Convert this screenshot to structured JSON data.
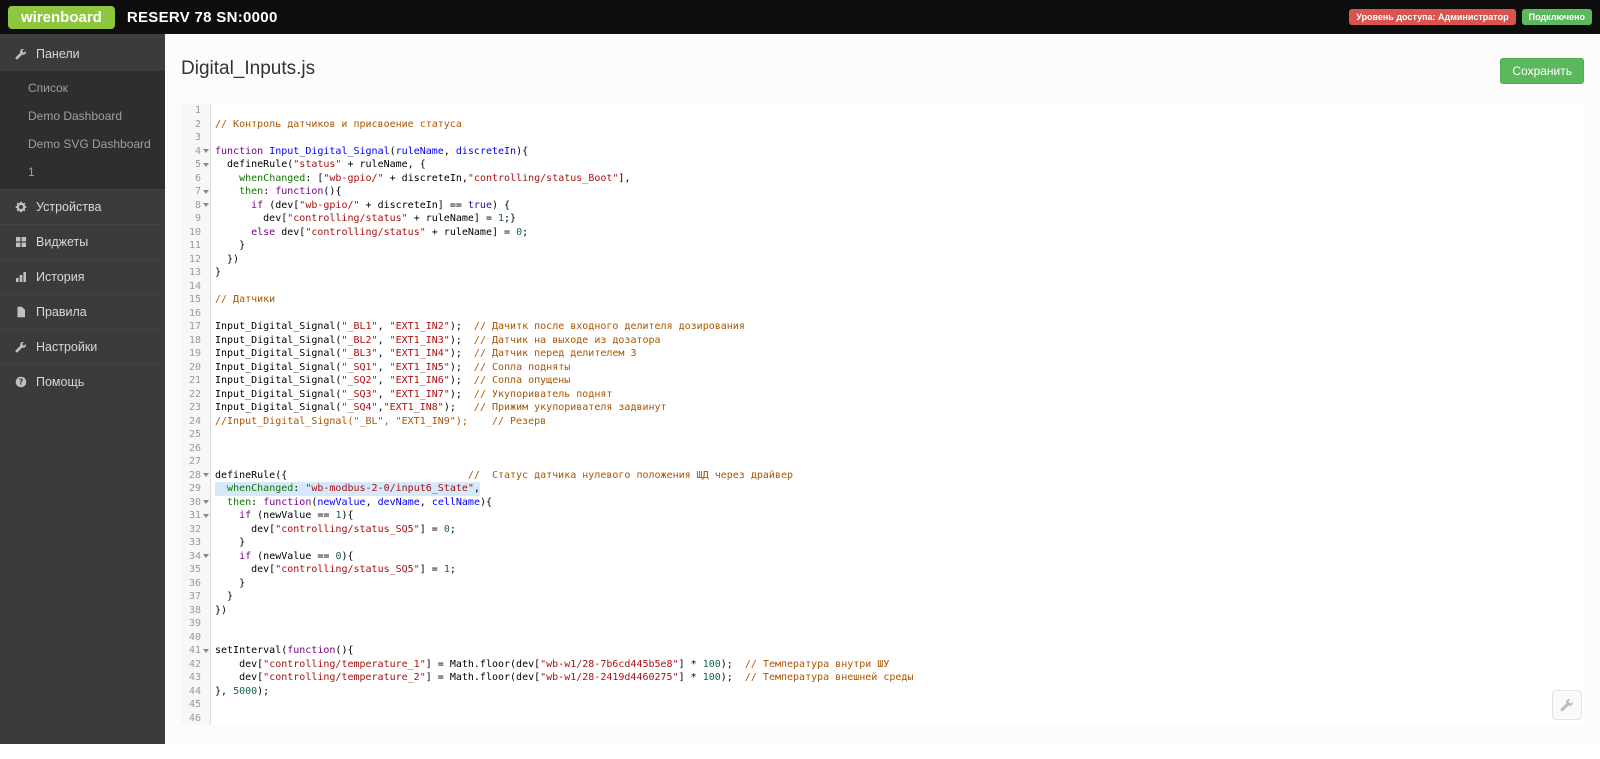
{
  "topbar": {
    "logo": "wirenboard",
    "title": "RESERV 78 SN:0000",
    "access_badge": "Уровень доступа: Администратор",
    "connection_badge": "Подключено",
    "colors": {
      "logo_green": "#8dc63f",
      "badge_red": "#d9534f",
      "badge_green": "#5cb85c"
    }
  },
  "sidebar": {
    "items": [
      {
        "id": "panels",
        "label": "Панели",
        "icon": "wrench",
        "children": [
          {
            "label": "Список"
          },
          {
            "label": "Demo Dashboard"
          },
          {
            "label": "Demo SVG Dashboard"
          },
          {
            "label": "1"
          }
        ]
      },
      {
        "id": "devices",
        "label": "Устройства",
        "icon": "gear"
      },
      {
        "id": "widgets",
        "label": "Виджеты",
        "icon": "widgets"
      },
      {
        "id": "history",
        "label": "История",
        "icon": "chart"
      },
      {
        "id": "rules",
        "label": "Правила",
        "icon": "file"
      },
      {
        "id": "settings",
        "label": "Настройки",
        "icon": "wrench"
      },
      {
        "id": "help",
        "label": "Помощь",
        "icon": "help"
      }
    ]
  },
  "main": {
    "title": "Digital_Inputs.js",
    "save_button": "Сохранить"
  },
  "editor": {
    "active_line": 29,
    "fold_lines": [
      4,
      5,
      7,
      8,
      28,
      30,
      31,
      34,
      41
    ],
    "lines": [
      [],
      [
        [
          "c",
          "// Контроль датчиков и присвоение статуса"
        ]
      ],
      [],
      [
        [
          "k",
          "function"
        ],
        [
          "p",
          " "
        ],
        [
          "d",
          "Input_Digital_Signal"
        ],
        [
          "p",
          "("
        ],
        [
          "d",
          "ruleName"
        ],
        [
          "p",
          ", "
        ],
        [
          "d",
          "discreteIn"
        ],
        [
          "p",
          "){"
        ]
      ],
      [
        [
          "p",
          "  defineRule("
        ],
        [
          "s",
          "\"status\""
        ],
        [
          "p",
          " + ruleName, {"
        ]
      ],
      [
        [
          "p",
          "    "
        ],
        [
          "o",
          "whenChanged"
        ],
        [
          "p",
          ": ["
        ],
        [
          "s",
          "\"wb-gpio/\""
        ],
        [
          "p",
          " + discreteIn,"
        ],
        [
          "s",
          "\"controlling/status_Boot\""
        ],
        [
          "p",
          "],"
        ]
      ],
      [
        [
          "p",
          "    "
        ],
        [
          "o",
          "then"
        ],
        [
          "p",
          ": "
        ],
        [
          "k",
          "function"
        ],
        [
          "p",
          "(){"
        ]
      ],
      [
        [
          "p",
          "      "
        ],
        [
          "k",
          "if"
        ],
        [
          "p",
          " (dev["
        ],
        [
          "s",
          "\"wb-gpio/\""
        ],
        [
          "p",
          " + discreteIn] == "
        ],
        [
          "a",
          "true"
        ],
        [
          "p",
          ") {"
        ]
      ],
      [
        [
          "p",
          "        dev["
        ],
        [
          "s",
          "\"controlling/status\""
        ],
        [
          "p",
          " + ruleName] = "
        ],
        [
          "n",
          "1"
        ],
        [
          "p",
          ";}"
        ]
      ],
      [
        [
          "p",
          "      "
        ],
        [
          "k",
          "else"
        ],
        [
          "p",
          " dev["
        ],
        [
          "s",
          "\"controlling/status\""
        ],
        [
          "p",
          " + ruleName] = "
        ],
        [
          "n",
          "0"
        ],
        [
          "p",
          ";"
        ]
      ],
      [
        [
          "p",
          "    }"
        ]
      ],
      [
        [
          "p",
          "  })"
        ]
      ],
      [
        [
          "p",
          "}"
        ]
      ],
      [],
      [
        [
          "c",
          "// Датчики"
        ]
      ],
      [],
      [
        [
          "p",
          "Input_Digital_Signal("
        ],
        [
          "s",
          "\"_BL1\""
        ],
        [
          "p",
          ", "
        ],
        [
          "s",
          "\"EXT1_IN2\""
        ],
        [
          "p",
          ");  "
        ],
        [
          "c",
          "// Дачитк после входного делителя дозирования"
        ]
      ],
      [
        [
          "p",
          "Input_Digital_Signal("
        ],
        [
          "s",
          "\"_BL2\""
        ],
        [
          "p",
          ", "
        ],
        [
          "s",
          "\"EXT1_IN3\""
        ],
        [
          "p",
          ");  "
        ],
        [
          "c",
          "// Датчик на выходе из дозатора"
        ]
      ],
      [
        [
          "p",
          "Input_Digital_Signal("
        ],
        [
          "s",
          "\"_BL3\""
        ],
        [
          "p",
          ", "
        ],
        [
          "s",
          "\"EXT1_IN4\""
        ],
        [
          "p",
          ");  "
        ],
        [
          "c",
          "// Датчик перед делителем 3"
        ]
      ],
      [
        [
          "p",
          "Input_Digital_Signal("
        ],
        [
          "s",
          "\"_SQ1\""
        ],
        [
          "p",
          ", "
        ],
        [
          "s",
          "\"EXT1_IN5\""
        ],
        [
          "p",
          ");  "
        ],
        [
          "c",
          "// Сопла подняты"
        ]
      ],
      [
        [
          "p",
          "Input_Digital_Signal("
        ],
        [
          "s",
          "\"_SQ2\""
        ],
        [
          "p",
          ", "
        ],
        [
          "s",
          "\"EXT1_IN6\""
        ],
        [
          "p",
          ");  "
        ],
        [
          "c",
          "// Сопла опущены"
        ]
      ],
      [
        [
          "p",
          "Input_Digital_Signal("
        ],
        [
          "s",
          "\"_SQ3\""
        ],
        [
          "p",
          ", "
        ],
        [
          "s",
          "\"EXT1_IN7\""
        ],
        [
          "p",
          ");  "
        ],
        [
          "c",
          "// Укупориватель поднят"
        ]
      ],
      [
        [
          "p",
          "Input_Digital_Signal("
        ],
        [
          "s",
          "\"_SQ4\""
        ],
        [
          "p",
          ","
        ],
        [
          "s",
          "\"EXT1_IN8\""
        ],
        [
          "p",
          ");   "
        ],
        [
          "c",
          "// Прижим укупоривателя задвинут"
        ]
      ],
      [
        [
          "c",
          "//Input_Digital_Signal(\"_BL\", \"EXT1_IN9\");    // Резерв"
        ]
      ],
      [],
      [],
      [],
      [
        [
          "p",
          "defineRule({                              "
        ],
        [
          "c",
          "//  Статус датчика нулевого положения ЩД через драйвер"
        ]
      ],
      [
        [
          "p",
          "  "
        ],
        [
          "o",
          "whenChanged"
        ],
        [
          "p",
          ": "
        ],
        [
          "s",
          "\"wb-modbus-2-0/input6_State\""
        ],
        [
          "p",
          ","
        ]
      ],
      [
        [
          "p",
          "  "
        ],
        [
          "o",
          "then"
        ],
        [
          "p",
          ": "
        ],
        [
          "k",
          "function"
        ],
        [
          "p",
          "("
        ],
        [
          "d",
          "newValue"
        ],
        [
          "p",
          ", "
        ],
        [
          "d",
          "devName"
        ],
        [
          "p",
          ", "
        ],
        [
          "d",
          "cellName"
        ],
        [
          "p",
          "){"
        ]
      ],
      [
        [
          "p",
          "    "
        ],
        [
          "k",
          "if"
        ],
        [
          "p",
          " (newValue == "
        ],
        [
          "n",
          "1"
        ],
        [
          "p",
          "){"
        ]
      ],
      [
        [
          "p",
          "      dev["
        ],
        [
          "s",
          "\"controlling/status_SQ5\""
        ],
        [
          "p",
          "] = "
        ],
        [
          "n",
          "0"
        ],
        [
          "p",
          ";"
        ]
      ],
      [
        [
          "p",
          "    }"
        ]
      ],
      [
        [
          "p",
          "    "
        ],
        [
          "k",
          "if"
        ],
        [
          "p",
          " (newValue == "
        ],
        [
          "n",
          "0"
        ],
        [
          "p",
          "){"
        ]
      ],
      [
        [
          "p",
          "      dev["
        ],
        [
          "s",
          "\"controlling/status_SQ5\""
        ],
        [
          "p",
          "] = "
        ],
        [
          "n",
          "1"
        ],
        [
          "p",
          ";"
        ]
      ],
      [
        [
          "p",
          "    }"
        ]
      ],
      [
        [
          "p",
          "  }"
        ]
      ],
      [
        [
          "p",
          "})"
        ]
      ],
      [],
      [],
      [
        [
          "p",
          "setInterval("
        ],
        [
          "k",
          "function"
        ],
        [
          "p",
          "(){"
        ]
      ],
      [
        [
          "p",
          "    dev["
        ],
        [
          "s",
          "\"controlling/temperature_1\""
        ],
        [
          "p",
          "] = Math.floor(dev["
        ],
        [
          "s",
          "\"wb-w1/28-7b6cd445b5e8\""
        ],
        [
          "p",
          "] * "
        ],
        [
          "n",
          "100"
        ],
        [
          "p",
          ");  "
        ],
        [
          "c",
          "// Температура внутри ШУ"
        ]
      ],
      [
        [
          "p",
          "    dev["
        ],
        [
          "s",
          "\"controlling/temperature_2\""
        ],
        [
          "p",
          "] = Math.floor(dev["
        ],
        [
          "s",
          "\"wb-w1/28-2419d4460275\""
        ],
        [
          "p",
          "] * "
        ],
        [
          "n",
          "100"
        ],
        [
          "p",
          ");  "
        ],
        [
          "c",
          "// Температура внешней среды"
        ]
      ],
      [
        [
          "p",
          "}, "
        ],
        [
          "n",
          "5000"
        ],
        [
          "p",
          ");"
        ]
      ],
      [],
      []
    ]
  }
}
